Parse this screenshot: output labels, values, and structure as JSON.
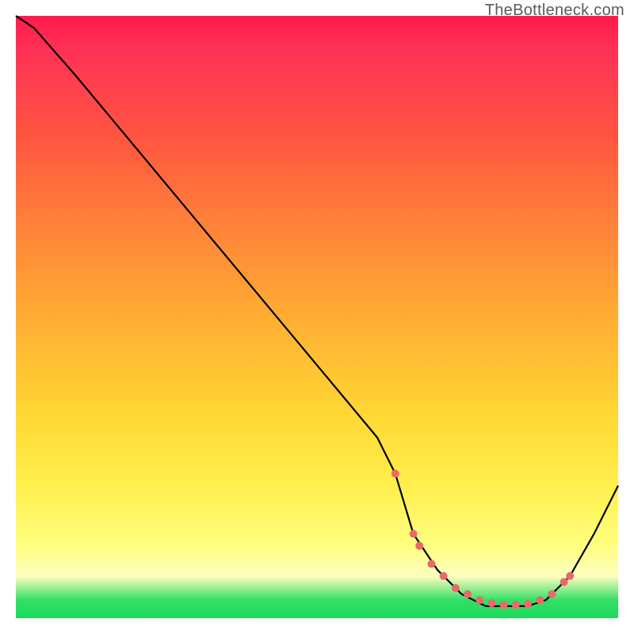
{
  "watermark": "TheBottleneck.com",
  "chart_data": {
    "type": "line",
    "title": "",
    "xlabel": "",
    "ylabel": "",
    "xlim": [
      0,
      100
    ],
    "ylim": [
      0,
      100
    ],
    "series": [
      {
        "name": "bottleneck-curve",
        "x": [
          0,
          3,
          10,
          20,
          30,
          40,
          50,
          60,
          63,
          66,
          70,
          74,
          78,
          82,
          85,
          88,
          92,
          96,
          100
        ],
        "values": [
          100,
          98,
          90,
          78,
          66,
          54,
          42,
          30,
          24,
          14,
          8,
          4,
          2,
          2,
          2,
          3,
          7,
          14,
          22
        ]
      }
    ],
    "markers": {
      "name": "highlight-dots",
      "color": "#e86a6a",
      "x": [
        63,
        66,
        67,
        69,
        71,
        73,
        75,
        77,
        79,
        81,
        83,
        85,
        87,
        89,
        91,
        92
      ],
      "values": [
        24,
        14,
        12,
        9,
        7,
        5,
        4,
        3,
        2.5,
        2.2,
        2.2,
        2.4,
        3,
        4,
        6,
        7
      ]
    },
    "gradient_stops": [
      {
        "pos": 0,
        "color": "#ff1a4d"
      },
      {
        "pos": 6,
        "color": "#ff3355"
      },
      {
        "pos": 20,
        "color": "#ff5540"
      },
      {
        "pos": 33,
        "color": "#ff7d3a"
      },
      {
        "pos": 50,
        "color": "#ffad33"
      },
      {
        "pos": 66,
        "color": "#ffd733"
      },
      {
        "pos": 78,
        "color": "#ffef4d"
      },
      {
        "pos": 88,
        "color": "#ffff80"
      },
      {
        "pos": 93,
        "color": "#fdffc0"
      },
      {
        "pos": 97,
        "color": "#33e066"
      },
      {
        "pos": 100,
        "color": "#1ad95c"
      }
    ]
  }
}
